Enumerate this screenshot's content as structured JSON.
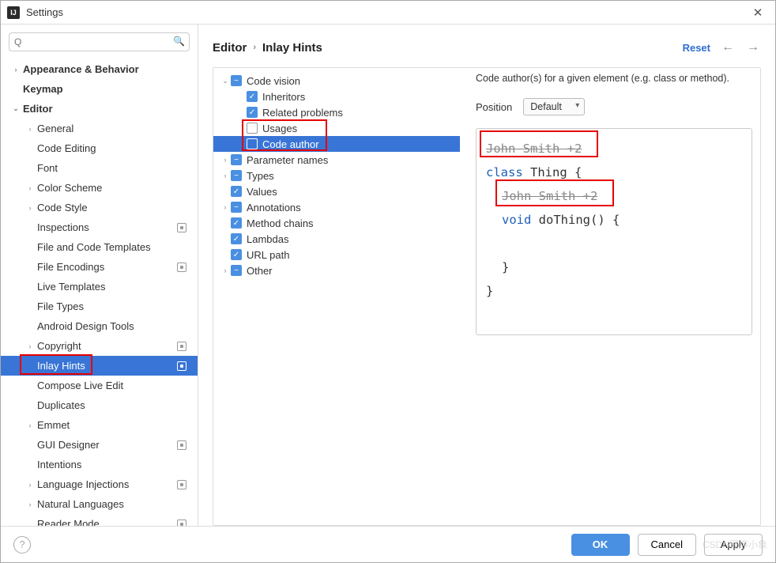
{
  "window": {
    "title": "Settings",
    "app_icon_text": "IJ"
  },
  "search": {
    "placeholder": "Q"
  },
  "sidebar_tree": [
    {
      "label": "Appearance & Behavior",
      "depth": 0,
      "chev": "›",
      "bold": true
    },
    {
      "label": "Keymap",
      "depth": 0,
      "chev": "",
      "bold": true
    },
    {
      "label": "Editor",
      "depth": 0,
      "chev": "⌄",
      "bold": true
    },
    {
      "label": "General",
      "depth": 1,
      "chev": "›"
    },
    {
      "label": "Code Editing",
      "depth": 1,
      "chev": ""
    },
    {
      "label": "Font",
      "depth": 1,
      "chev": ""
    },
    {
      "label": "Color Scheme",
      "depth": 1,
      "chev": "›"
    },
    {
      "label": "Code Style",
      "depth": 1,
      "chev": "›"
    },
    {
      "label": "Inspections",
      "depth": 1,
      "chev": "",
      "mod": true
    },
    {
      "label": "File and Code Templates",
      "depth": 1,
      "chev": ""
    },
    {
      "label": "File Encodings",
      "depth": 1,
      "chev": "",
      "mod": true
    },
    {
      "label": "Live Templates",
      "depth": 1,
      "chev": ""
    },
    {
      "label": "File Types",
      "depth": 1,
      "chev": ""
    },
    {
      "label": "Android Design Tools",
      "depth": 1,
      "chev": ""
    },
    {
      "label": "Copyright",
      "depth": 1,
      "chev": "›",
      "mod": true
    },
    {
      "label": "Inlay Hints",
      "depth": 1,
      "chev": "",
      "mod": true,
      "selected": true,
      "highlight": true
    },
    {
      "label": "Compose Live Edit",
      "depth": 1,
      "chev": ""
    },
    {
      "label": "Duplicates",
      "depth": 1,
      "chev": ""
    },
    {
      "label": "Emmet",
      "depth": 1,
      "chev": "›"
    },
    {
      "label": "GUI Designer",
      "depth": 1,
      "chev": "",
      "mod": true
    },
    {
      "label": "Intentions",
      "depth": 1,
      "chev": ""
    },
    {
      "label": "Language Injections",
      "depth": 1,
      "chev": "›",
      "mod": true
    },
    {
      "label": "Natural Languages",
      "depth": 1,
      "chev": "›"
    },
    {
      "label": "Reader Mode",
      "depth": 1,
      "chev": "",
      "mod": true
    }
  ],
  "breadcrumb": {
    "part1": "Editor",
    "part2": "Inlay Hints"
  },
  "header": {
    "reset": "Reset"
  },
  "mid_tree": [
    {
      "indent": 0,
      "chev": "⌄",
      "box": "minus",
      "label": "Code vision"
    },
    {
      "indent": 1,
      "chev": "",
      "box": "checked",
      "label": "Inheritors"
    },
    {
      "indent": 1,
      "chev": "",
      "box": "checked",
      "label": "Related problems"
    },
    {
      "indent": 1,
      "chev": "",
      "box": "empty",
      "label": "Usages",
      "top_highlight": true
    },
    {
      "indent": 1,
      "chev": "",
      "box": "empty",
      "label": "Code author",
      "selected": true,
      "highlight": true
    },
    {
      "indent": 0,
      "chev": "›",
      "box": "minus",
      "label": "Parameter names"
    },
    {
      "indent": 0,
      "chev": "›",
      "box": "minus",
      "label": "Types"
    },
    {
      "indent": 0,
      "chev": "",
      "box": "checked",
      "label": "Values"
    },
    {
      "indent": 0,
      "chev": "›",
      "box": "minus",
      "label": "Annotations"
    },
    {
      "indent": 0,
      "chev": "",
      "box": "checked",
      "label": "Method chains"
    },
    {
      "indent": 0,
      "chev": "",
      "box": "checked",
      "label": "Lambdas"
    },
    {
      "indent": 0,
      "chev": "",
      "box": "checked",
      "label": "URL path"
    },
    {
      "indent": 0,
      "chev": "›",
      "box": "minus",
      "label": "Other"
    }
  ],
  "right": {
    "description": "Code author(s) for a given element (e.g. class or method).",
    "position_label": "Position",
    "position_value": "Default",
    "code": {
      "hint1": "John Smith +2",
      "line1_kw": "class",
      "line1_id": "Thing {",
      "hint2": "John Smith +2",
      "line2_kw": "void",
      "line2_id": "doThing() {",
      "brace_inner": "}",
      "brace_outer": "}"
    }
  },
  "buttons": {
    "ok": "OK",
    "cancel": "Cancel",
    "apply": "Apply"
  },
  "watermark": "CSDN程序小象"
}
